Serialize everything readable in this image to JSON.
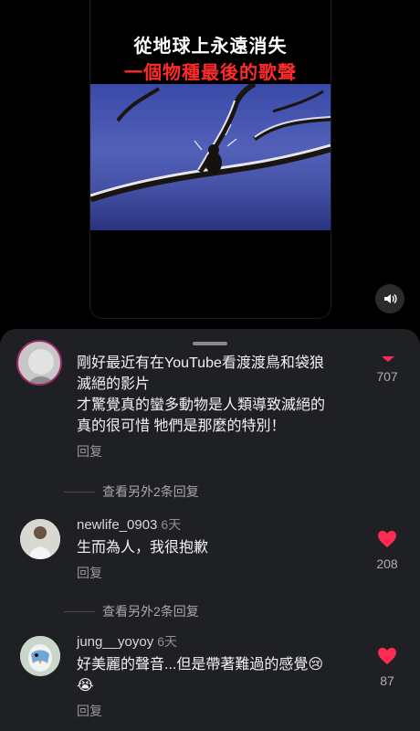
{
  "video": {
    "caption_line1": "從地球上永遠消失",
    "caption_line2": "一個物種最後的歌聲",
    "sound_icon": "speaker-icon"
  },
  "comments": [
    {
      "username": "",
      "time": "",
      "text_lines": [
        "剛好最近有在YouTube看渡渡鳥和袋狼",
        "滅絕的影片",
        "才驚覺真的蠻多動物是人類導致滅絕的",
        "真的很可惜 牠們是那麼的特別！"
      ],
      "reply_label": "回复",
      "likes": "707",
      "more_replies": "查看另外2条回复"
    },
    {
      "username": "newlife_0903",
      "time": "6天",
      "text_lines": [
        "生而為人，我很抱歉"
      ],
      "reply_label": "回复",
      "likes": "208",
      "more_replies": "查看另外2条回复"
    },
    {
      "username": "jung__yoyoy",
      "time": "6天",
      "text_lines": [
        "好美麗的聲音...但是帶著難過的感覺😢",
        "😭"
      ],
      "reply_label": "回复",
      "likes": "87"
    }
  ],
  "colors": {
    "like_red": "#fe2c55",
    "caption_red": "#ff2a2a",
    "sheet_bg": "#1f2023"
  }
}
